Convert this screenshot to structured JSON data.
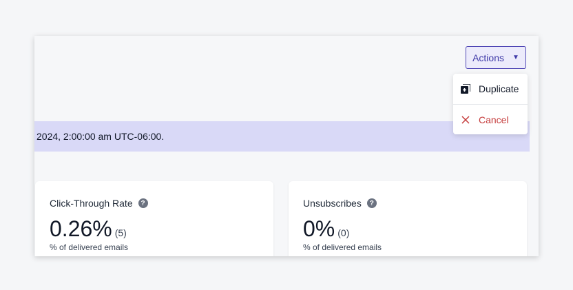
{
  "header": {
    "actions_label": "Actions"
  },
  "menu": {
    "items": [
      {
        "label": "Duplicate",
        "icon": "duplicate-icon"
      },
      {
        "label": "Cancel",
        "icon": "close-icon"
      }
    ]
  },
  "banner": {
    "text": "2024, 2:00:00 am UTC-06:00."
  },
  "cards": [
    {
      "title": "Click-Through Rate",
      "value": "0.26%",
      "count": "(5)",
      "subtitle": "% of delivered emails"
    },
    {
      "title": "Unsubscribes",
      "value": "0%",
      "count": "(0)",
      "subtitle": "% of delivered emails"
    }
  ],
  "colors": {
    "accent": "#4f46b5",
    "banner_bg": "#d9d9f7",
    "danger": "#c53b3b"
  }
}
